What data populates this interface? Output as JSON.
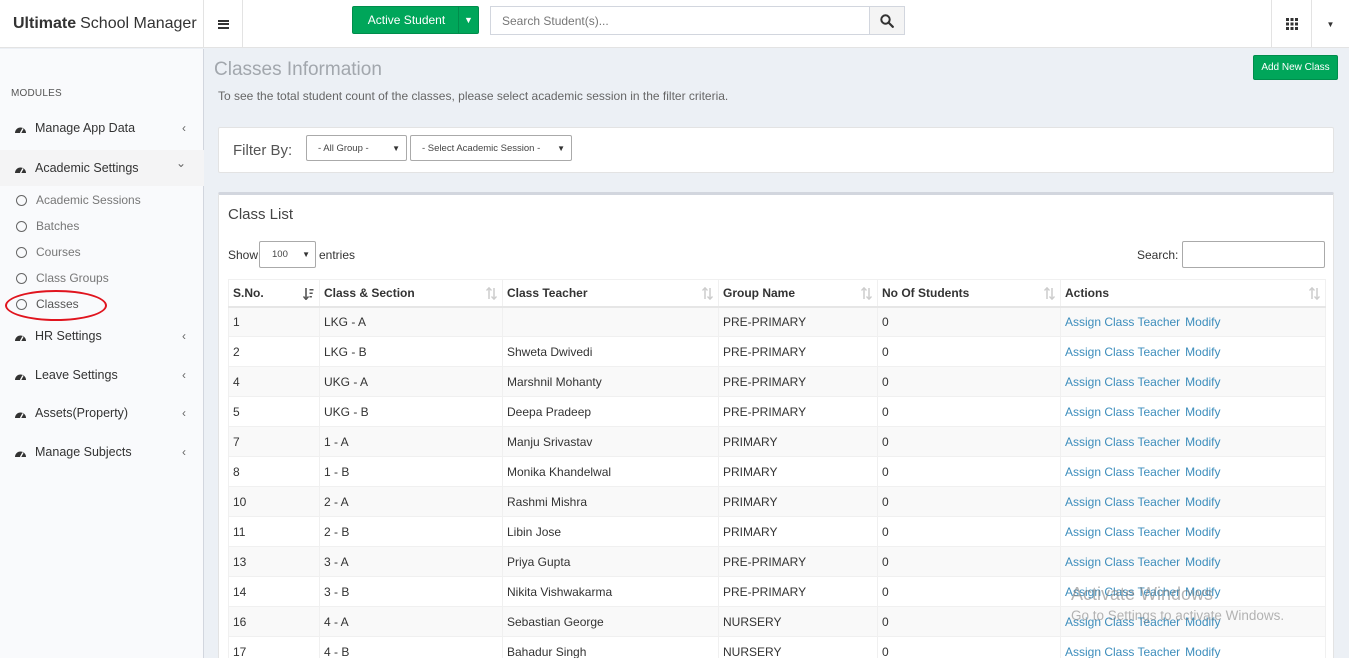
{
  "app": {
    "brand_bold": "Ultimate",
    "brand_rest": "School Manager"
  },
  "header": {
    "active_student_label": "Active Student",
    "search_placeholder": "Search Student(s)..."
  },
  "sidebar": {
    "modules_label": "MODULES",
    "items": [
      {
        "label": "Manage App Data",
        "chevron": "‹"
      },
      {
        "label": "Academic Settings",
        "chevron": "⌄"
      },
      {
        "label": "HR Settings",
        "chevron": "‹"
      },
      {
        "label": "Leave Settings",
        "chevron": "‹"
      },
      {
        "label": "Assets(Property)",
        "chevron": "‹"
      },
      {
        "label": "Manage Subjects",
        "chevron": "‹"
      }
    ],
    "sub_items": [
      {
        "label": "Academic Sessions"
      },
      {
        "label": "Batches"
      },
      {
        "label": "Courses"
      },
      {
        "label": "Class Groups"
      },
      {
        "label": "Classes"
      }
    ]
  },
  "page": {
    "title": "Classes Information",
    "subtitle": "To see the total student count of the classes, please select academic session in the filter criteria.",
    "add_button": "Add New Class"
  },
  "filter": {
    "label": "Filter By:",
    "group_select": "- All Group -",
    "session_select": "- Select Academic Session -"
  },
  "class_list": {
    "title": "Class List",
    "show_label": "Show",
    "entries_value": "100",
    "entries_label": "entries",
    "search_label": "Search:",
    "columns": [
      "S.No.",
      "Class & Section",
      "Class Teacher",
      "Group Name",
      "No Of Students",
      "Actions"
    ],
    "action_assign": "Assign Class Teacher",
    "action_modify": "Modify",
    "rows": [
      {
        "sno": "1",
        "class": "LKG - A",
        "teacher": "",
        "group": "PRE-PRIMARY",
        "students": "0"
      },
      {
        "sno": "2",
        "class": "LKG - B",
        "teacher": "Shweta Dwivedi",
        "group": "PRE-PRIMARY",
        "students": "0"
      },
      {
        "sno": "4",
        "class": "UKG - A",
        "teacher": "Marshnil Mohanty",
        "group": "PRE-PRIMARY",
        "students": "0"
      },
      {
        "sno": "5",
        "class": "UKG - B",
        "teacher": "Deepa Pradeep",
        "group": "PRE-PRIMARY",
        "students": "0"
      },
      {
        "sno": "7",
        "class": "1 - A",
        "teacher": "Manju Srivastav",
        "group": "PRIMARY",
        "students": "0"
      },
      {
        "sno": "8",
        "class": "1 - B",
        "teacher": "Monika Khandelwal",
        "group": "PRIMARY",
        "students": "0"
      },
      {
        "sno": "10",
        "class": "2 - A",
        "teacher": "Rashmi Mishra",
        "group": "PRIMARY",
        "students": "0"
      },
      {
        "sno": "11",
        "class": "2 - B",
        "teacher": "Libin Jose",
        "group": "PRIMARY",
        "students": "0"
      },
      {
        "sno": "13",
        "class": "3 - A",
        "teacher": "Priya Gupta",
        "group": "PRE-PRIMARY",
        "students": "0"
      },
      {
        "sno": "14",
        "class": "3 - B",
        "teacher": "Nikita Vishwakarma",
        "group": "PRE-PRIMARY",
        "students": "0"
      },
      {
        "sno": "16",
        "class": "4 - A",
        "teacher": "Sebastian George",
        "group": "NURSERY",
        "students": "0"
      },
      {
        "sno": "17",
        "class": "4 - B",
        "teacher": "Bahadur Singh",
        "group": "NURSERY",
        "students": "0"
      }
    ]
  },
  "watermark": {
    "line1": "Activate Windows",
    "line2": "Go to Settings to activate Windows."
  },
  "colors": {
    "accent_green": "#00a65a",
    "link_blue": "#3c8dbc",
    "highlight_red": "#e0141e"
  }
}
